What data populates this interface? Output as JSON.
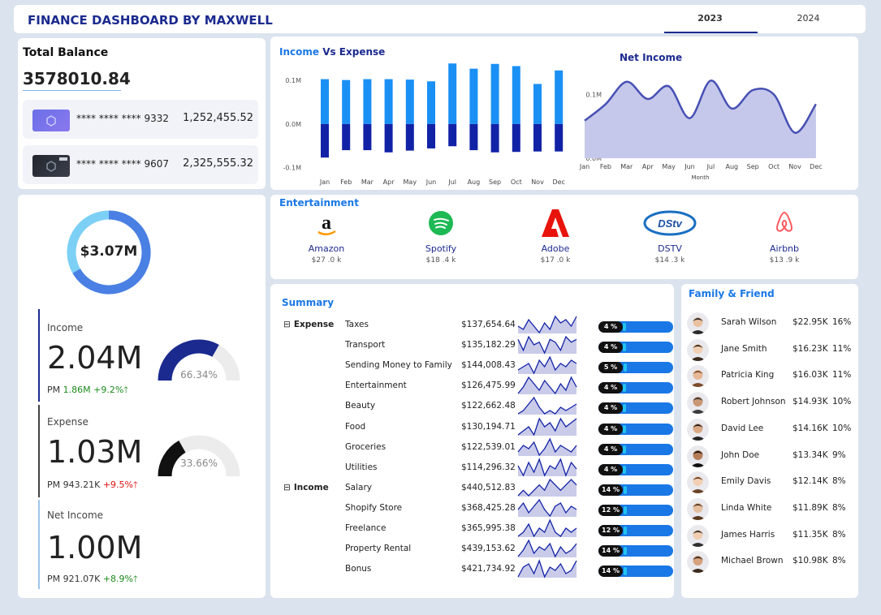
{
  "header": {
    "title": "FINANCE DASHBOARD BY MAXWELL",
    "tabs": [
      "2023",
      "2024"
    ]
  },
  "balance": {
    "title": "Total Balance",
    "value": "3578010.84",
    "cards": [
      {
        "number": "**** **** **** 9332",
        "amount": "1,252,455.52"
      },
      {
        "number": "**** **** **** 9607",
        "amount": "2,325,555.32"
      }
    ]
  },
  "donut": {
    "value": "$3.07M"
  },
  "kpis": [
    {
      "label": "Income",
      "value": "2.04M",
      "pm": "PM",
      "prev": "1.86M",
      "change": "+9.2%",
      "arrow": "🡑",
      "gauge_text": "66.34%",
      "gauge_fraction": 0.6634
    },
    {
      "label": "Expense",
      "value": "1.03M",
      "pm": "PM",
      "prev": "943.21K",
      "change": "+9.5%",
      "arrow": "🡑",
      "gauge_text": "33.66%",
      "gauge_fraction": 0.3366
    },
    {
      "label": "Net Income",
      "value": "1.00M",
      "pm": "PM",
      "prev": "921.07K",
      "change": "+8.9%",
      "arrow": "🡑"
    }
  ],
  "colors": {
    "primary": "#1b2a8f",
    "income": "#1a90f5",
    "expense": "#1222a6",
    "net_fill": "#c5c8ea",
    "net_line": "#4750b4",
    "green": "#1a8a1a",
    "red": "#e01010",
    "pill": "#1a78e6",
    "spark_fill": "#c9cbe9"
  },
  "chart_data": [
    {
      "type": "bar",
      "title": "Income Vs Expense",
      "title_parts": [
        "Income",
        "Vs Expense"
      ],
      "categories": [
        "Jan",
        "Feb",
        "Mar",
        "Apr",
        "May",
        "Jun",
        "Jul",
        "Aug",
        "Sep",
        "Oct",
        "Nov",
        "Dec"
      ],
      "yticks": [
        "0.1M",
        "0.0M",
        "-0.1M"
      ],
      "ylim": [
        -0.125,
        0.145
      ],
      "series": [
        {
          "name": "Income",
          "values": [
            0.103,
            0.101,
            0.103,
            0.103,
            0.102,
            0.098,
            0.139,
            0.127,
            0.138,
            0.133,
            0.092,
            0.123
          ]
        },
        {
          "name": "Expense",
          "values": [
            -0.077,
            -0.06,
            -0.06,
            -0.065,
            -0.061,
            -0.056,
            -0.051,
            -0.06,
            -0.065,
            -0.064,
            -0.063,
            -0.063
          ]
        }
      ]
    },
    {
      "type": "area",
      "title": "Net Income",
      "xlabel": "Month",
      "yticks": [
        "0.1M",
        "0.0M"
      ],
      "ylim": [
        0,
        0.13
      ],
      "categories": [
        "Jan",
        "Feb",
        "Mar",
        "Apr",
        "May",
        "Jun",
        "Jul",
        "Aug",
        "Sep",
        "Oct",
        "Nov",
        "Dec"
      ],
      "values": [
        0.059,
        0.085,
        0.12,
        0.093,
        0.113,
        0.063,
        0.122,
        0.078,
        0.107,
        0.1,
        0.04,
        0.085
      ]
    }
  ],
  "entertainment": {
    "title": "Entertainment",
    "items": [
      {
        "name": "Amazon",
        "value": "$27 .0 k",
        "icon": "amazon-logo"
      },
      {
        "name": "Spotify",
        "value": "$18 .4 k",
        "icon": "spotify-logo"
      },
      {
        "name": "Adobe",
        "value": "$17 .0 k",
        "icon": "adobe-logo"
      },
      {
        "name": "DSTV",
        "value": "$14 .3 k",
        "icon": "dstv-logo"
      },
      {
        "name": "Airbnb",
        "value": "$13 .9 k",
        "icon": "airbnb-logo"
      }
    ]
  },
  "summary": {
    "title": "Summary",
    "collapse_glyph": "⊟",
    "groups": [
      {
        "category": "Expense",
        "rows": [
          {
            "item": "Taxes",
            "amount": "$137,654.64",
            "pct": "4 %",
            "fraction": 0.04,
            "spark": [
              5,
              4,
              7,
              5,
              3,
              6,
              4,
              8,
              6,
              7,
              5,
              8
            ]
          },
          {
            "item": "Transport",
            "amount": "$135,182.29",
            "pct": "4 %",
            "fraction": 0.04,
            "spark": [
              7,
              3,
              8,
              5,
              6,
              2,
              7,
              6,
              3,
              8,
              6,
              7
            ]
          },
          {
            "item": "Sending Money to Family",
            "amount": "$144,008.43",
            "pct": "5 %",
            "fraction": 0.05,
            "spark": [
              4,
              5,
              6,
              3,
              7,
              5,
              8,
              4,
              6,
              5,
              7,
              6
            ]
          },
          {
            "item": "Entertainment",
            "amount": "$126,475.99",
            "pct": "4 %",
            "fraction": 0.04,
            "spark": [
              3,
              5,
              8,
              6,
              4,
              7,
              5,
              3,
              6,
              4,
              8,
              5
            ]
          },
          {
            "item": "Beauty",
            "amount": "$122,662.48",
            "pct": "4 %",
            "fraction": 0.04,
            "spark": [
              3,
              4,
              6,
              8,
              5,
              3,
              4,
              3,
              5,
              4,
              5,
              6
            ]
          },
          {
            "item": "Food",
            "amount": "$130,194.71",
            "pct": "4 %",
            "fraction": 0.04,
            "spark": [
              3,
              4,
              5,
              3,
              7,
              5,
              6,
              4,
              7,
              5,
              6,
              7
            ]
          },
          {
            "item": "Groceries",
            "amount": "$122,539.01",
            "pct": "4 %",
            "fraction": 0.04,
            "spark": [
              4,
              6,
              5,
              7,
              3,
              5,
              8,
              4,
              6,
              5,
              4,
              6
            ]
          },
          {
            "item": "Utilities",
            "amount": "$114,296.32",
            "pct": "4 %",
            "fraction": 0.04,
            "spark": [
              6,
              3,
              7,
              4,
              8,
              3,
              6,
              5,
              8,
              3,
              7,
              5
            ]
          }
        ]
      },
      {
        "category": "Income",
        "rows": [
          {
            "item": "Salary",
            "amount": "$440,512.83",
            "pct": "14 %",
            "fraction": 0.14,
            "spark": [
              4,
              5,
              4,
              5,
              6,
              5,
              7,
              6,
              5,
              6,
              7,
              6
            ]
          },
          {
            "item": "Shopify Store",
            "amount": "$368,425.28",
            "pct": "12 %",
            "fraction": 0.12,
            "spark": [
              5,
              7,
              4,
              6,
              8,
              5,
              3,
              6,
              7,
              4,
              6,
              5
            ]
          },
          {
            "item": "Freelance",
            "amount": "$365,995.38",
            "pct": "12 %",
            "fraction": 0.12,
            "spark": [
              4,
              5,
              7,
              4,
              6,
              5,
              8,
              5,
              4,
              6,
              5,
              6
            ]
          },
          {
            "item": "Property Rental",
            "amount": "$439,153.62",
            "pct": "14 %",
            "fraction": 0.14,
            "spark": [
              3,
              5,
              8,
              4,
              6,
              5,
              7,
              3,
              6,
              4,
              5,
              7
            ]
          },
          {
            "item": "Bonus",
            "amount": "$421,734.92",
            "pct": "14 %",
            "fraction": 0.14,
            "spark": [
              3,
              6,
              7,
              4,
              8,
              3,
              6,
              5,
              7,
              4,
              5,
              8
            ]
          }
        ]
      }
    ]
  },
  "family": {
    "title": "Family & Friend",
    "rows": [
      {
        "name": "Sarah Wilson",
        "amount": "$22.95K",
        "pct": "16%"
      },
      {
        "name": "Jane Smith",
        "amount": "$16.23K",
        "pct": "11%"
      },
      {
        "name": "Patricia King",
        "amount": "$16.03K",
        "pct": "11%"
      },
      {
        "name": "Robert Johnson",
        "amount": "$14.93K",
        "pct": "10%"
      },
      {
        "name": "David Lee",
        "amount": "$14.16K",
        "pct": "10%"
      },
      {
        "name": "John Doe",
        "amount": "$13.34K",
        "pct": "9%"
      },
      {
        "name": "Emily Davis",
        "amount": "$12.14K",
        "pct": "8%"
      },
      {
        "name": "Linda White",
        "amount": "$11.89K",
        "pct": "8%"
      },
      {
        "name": "James Harris",
        "amount": "$11.35K",
        "pct": "8%"
      },
      {
        "name": "Michael Brown",
        "amount": "$10.98K",
        "pct": "8%"
      }
    ]
  }
}
